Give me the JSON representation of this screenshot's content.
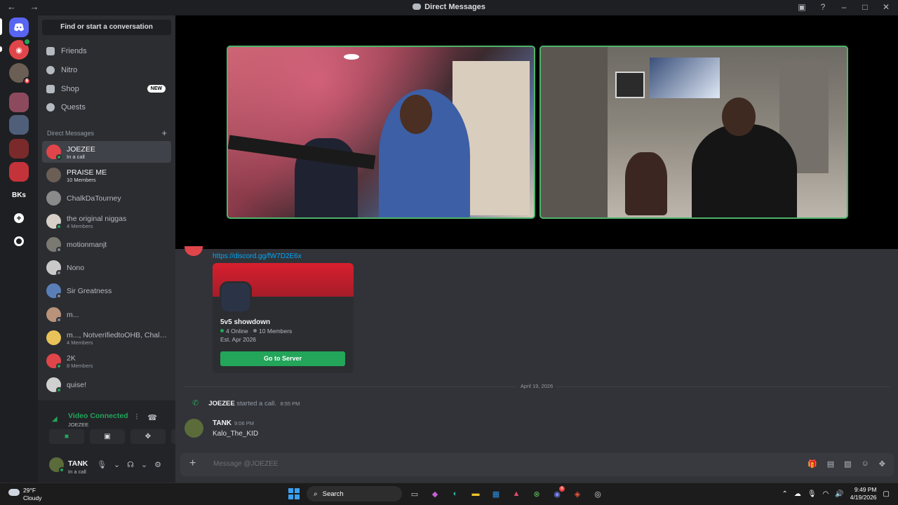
{
  "window": {
    "title": "Direct Messages",
    "nav_back": "←",
    "nav_forward": "→"
  },
  "rail": {
    "home_icon": "discord-icon",
    "bks_label": "BKs",
    "add_label": "+",
    "unread_badge": "6"
  },
  "sidebar": {
    "search_label": "Find or start a conversation",
    "nav": [
      {
        "label": "Friends",
        "icon": "friends-icon"
      },
      {
        "label": "Nitro",
        "icon": "nitro-icon"
      },
      {
        "label": "Shop",
        "icon": "shop-icon",
        "tag": "NEW"
      },
      {
        "label": "Quests",
        "icon": "quests-icon"
      }
    ],
    "dm_header": "Direct Messages",
    "dm_add": "+",
    "dms": [
      {
        "name": "JOEZEE",
        "sub": "In a call",
        "color": "#e0454a",
        "status": "online"
      },
      {
        "name": "PRAISE ME",
        "sub": "10 Members",
        "color": "#6b5e55",
        "status": "none"
      },
      {
        "name": "ChalkDaTourney",
        "sub": "",
        "color": "#8a8a8a",
        "status": "none"
      },
      {
        "name": "the original niggas",
        "sub": "4 Members",
        "color": "#d6d0c8",
        "status": "none"
      },
      {
        "name": "motionmanjt",
        "sub": "",
        "color": "#7a7a72",
        "status": "offline"
      },
      {
        "name": "Nono",
        "sub": "",
        "color": "#c9c9c9",
        "status": "offline"
      },
      {
        "name": "Sir Greatness",
        "sub": "",
        "color": "#5a7fb8",
        "status": "offline"
      },
      {
        "name": "m...",
        "sub": "",
        "color": "#b8927a",
        "status": "offline"
      },
      {
        "name": "m..., NotverifiedtoOHB, Chalk...",
        "sub": "4 Members",
        "color": "#e8c35a",
        "status": "none"
      },
      {
        "name": "2K",
        "sub": "8 Members",
        "color": "#e0454a",
        "status": "none"
      },
      {
        "name": "quise!",
        "sub": "",
        "color": "#d0d0d0",
        "status": "none"
      }
    ]
  },
  "voice": {
    "title": "Video Connected",
    "channel": "JOEZEE",
    "user_name": "TANK",
    "user_status": "In a call"
  },
  "chat": {
    "link": "https://discord.gg/fW7D2E6x",
    "invite": {
      "name": "5v5 showdown",
      "online": "4 Online",
      "members": "10 Members",
      "est": "Est. Apr 2026",
      "button": "Go to Server",
      "banner_color": "#d81f2e"
    },
    "date_divider": "April 19, 2026",
    "call_user": "JOEZEE",
    "call_text": "started a call.",
    "call_time": "8:55 PM",
    "message": {
      "author": "TANK",
      "time": "9:06 PM",
      "text": "Kalo_The_KID"
    },
    "composer_placeholder": "Message @JOEZEE"
  },
  "taskbar": {
    "temp": "29°F",
    "condition": "Cloudy",
    "search_label": "Search",
    "time": "9:49 PM",
    "date": "4/19/2026",
    "discord_badge": "6"
  }
}
